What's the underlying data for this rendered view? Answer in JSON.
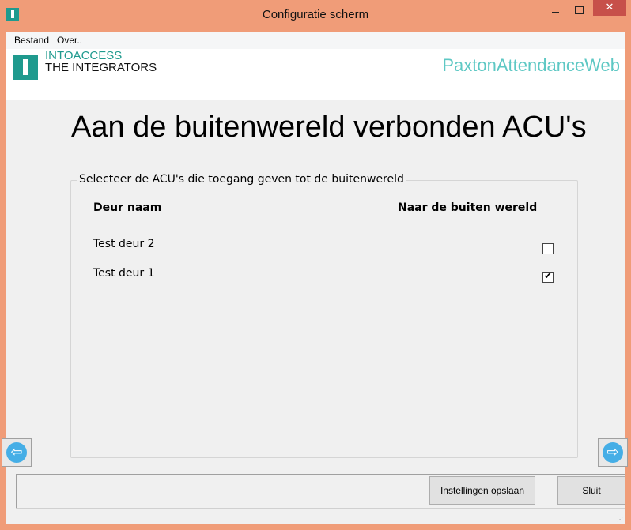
{
  "window": {
    "title": "Configuratie scherm",
    "close_glyph": "✕"
  },
  "menu": {
    "items": [
      "Bestand",
      "Over.."
    ]
  },
  "header": {
    "logo_line1": "INTOACCESS",
    "logo_line2": "THE INTEGRATORS",
    "product": "PaxtonAttendanceWeb"
  },
  "page": {
    "title": "Aan de buitenwereld verbonden ACU's"
  },
  "group": {
    "legend": "Selecteer de ACU's die toegang geven tot de buitenwereld",
    "columns": {
      "name": "Deur naam",
      "outside": "Naar de buiten wereld"
    },
    "rows": [
      {
        "name": "Test deur 2",
        "checked": false
      },
      {
        "name": "Test deur 1",
        "checked": true
      }
    ]
  },
  "nav": {
    "prev_glyph": "⇦",
    "next_glyph": "⇨"
  },
  "buttons": {
    "save": "Instellingen opslaan",
    "close": "Sluit"
  },
  "colors": {
    "accent": "#1f9a8e",
    "titlebar": "#f09c78",
    "close": "#c7504a",
    "nav": "#45aee6"
  }
}
